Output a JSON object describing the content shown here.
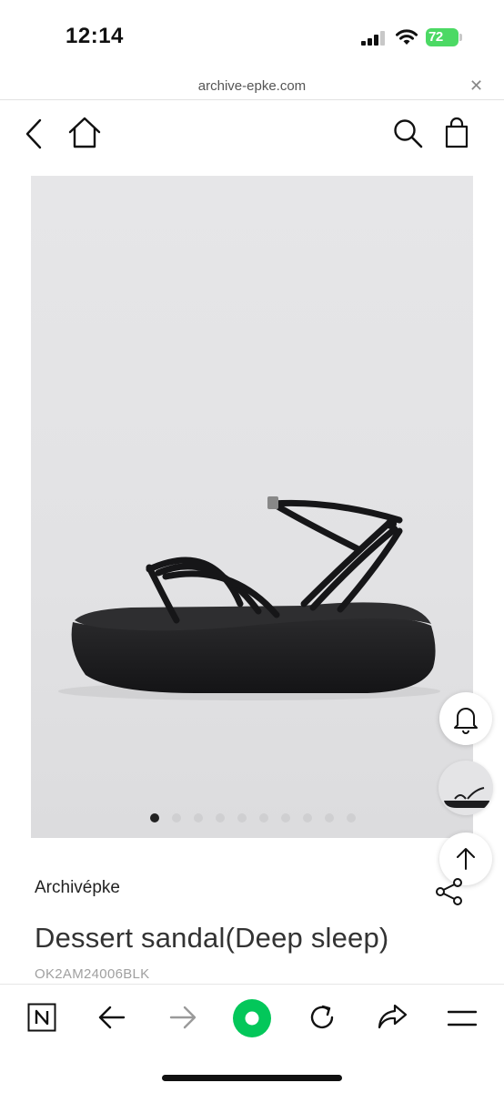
{
  "status": {
    "time": "12:14",
    "battery_level": "72",
    "signal_bars": 3,
    "battery_color": "#4cd964"
  },
  "browser": {
    "url": "archive-epke.com",
    "close_icon": "close-icon"
  },
  "header": {
    "icons": [
      "back-chevron-icon",
      "home-icon",
      "search-icon",
      "shopping-bag-icon"
    ]
  },
  "gallery": {
    "image_count": 10,
    "active_index": 0
  },
  "floating": {
    "icons": [
      "bell-icon",
      "recent-product-thumbnail",
      "arrow-up-icon"
    ]
  },
  "product": {
    "brand": "Archivépke",
    "title": "Dessert sandal(Deep sleep)",
    "code": "OK2AM24006BLK"
  },
  "toolbar": {
    "icons": [
      "naver-n-icon",
      "back-arrow-icon",
      "forward-arrow-icon",
      "green-dot-icon",
      "reload-icon",
      "share-icon",
      "menu-icon"
    ],
    "accent": "#03c75a"
  }
}
